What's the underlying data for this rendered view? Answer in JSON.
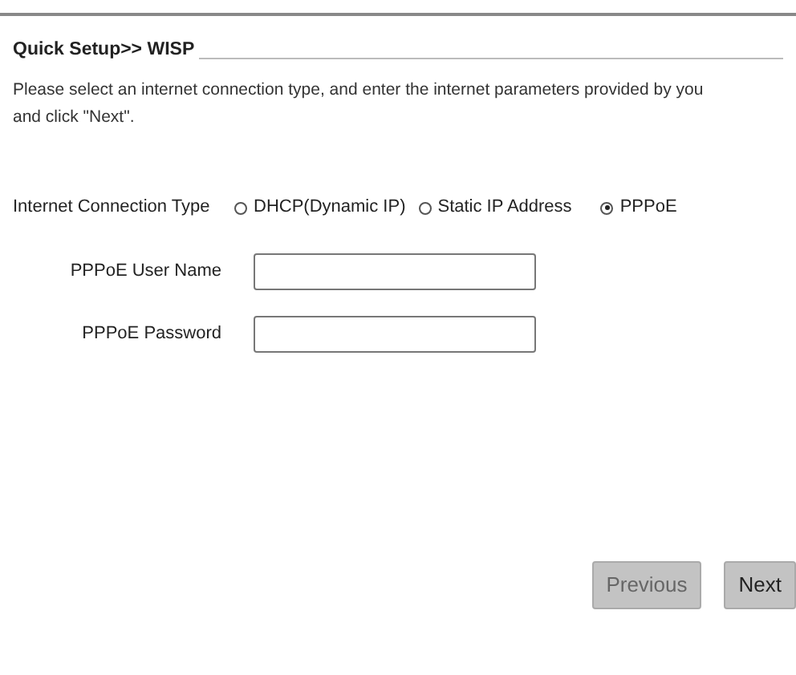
{
  "title": "Quick Setup>> WISP",
  "description_lines": [
    "Please select an internet connection type, and enter the internet parameters provided by you",
    "and click \"Next\"."
  ],
  "connection_type": {
    "label": "Internet Connection Type",
    "options": [
      {
        "label": "DHCP(Dynamic IP)",
        "selected": false
      },
      {
        "label": "Static IP Address",
        "selected": false
      },
      {
        "label": "PPPoE",
        "selected": true
      }
    ]
  },
  "fields": [
    {
      "label": "PPPoE User Name"
    },
    {
      "label": "PPPoE Password"
    }
  ],
  "buttons": [
    {
      "label": "Previous",
      "disabled": true
    },
    {
      "label": "Next",
      "disabled": false
    }
  ]
}
